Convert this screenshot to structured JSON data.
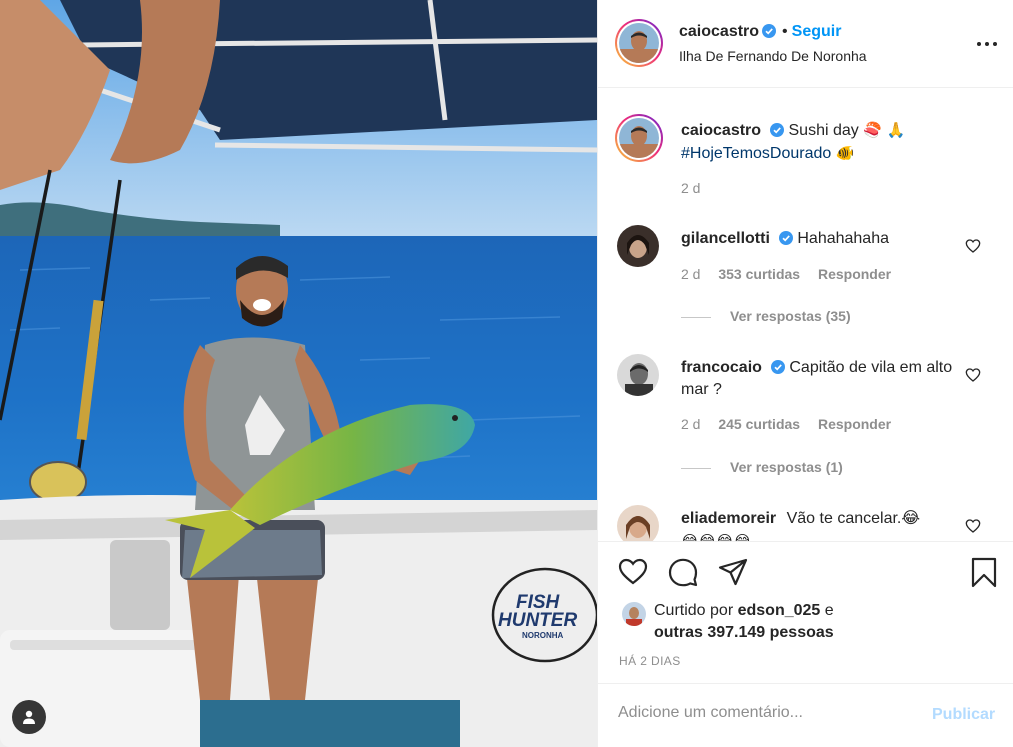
{
  "colors": {
    "accent": "#0095f6",
    "text": "#262626",
    "muted": "#8e8e8e",
    "hashtag": "#00376b",
    "publish_disabled": "#b3dbff",
    "verified": "#3897f0"
  },
  "media": {
    "tag_icon": "user-tag-icon",
    "boat_logo_line1": "FISH",
    "boat_logo_line2": "HUNTER",
    "boat_logo_line3": "NORONHA"
  },
  "header": {
    "username": "caiocastro",
    "verified": true,
    "separator": "•",
    "follow_label": "Seguir",
    "location": "Ilha De Fernando De Noronha",
    "more_icon": "more-options-icon"
  },
  "caption": {
    "username": "caiocastro",
    "text": "Sushi day",
    "emojis": "🍣 🙏",
    "hashtag": "#HojeTemosDourado",
    "hashtag_emoji": "🐠",
    "time": "2 d"
  },
  "comments": [
    {
      "username": "gilancellotti",
      "verified": true,
      "text": "Hahahahaha",
      "time": "2 d",
      "likes": "353 curtidas",
      "reply_label": "Responder",
      "view_replies": "Ver respostas (35)"
    },
    {
      "username": "francocaio",
      "verified": true,
      "text": "Capitão de vila em alto mar ?",
      "time": "2 d",
      "likes": "245 curtidas",
      "reply_label": "Responder",
      "view_replies": "Ver respostas (1)"
    },
    {
      "username": "eliademoreir",
      "verified": false,
      "text": "Vão te cancelar.😂",
      "text_cont": "😂😂😂😂"
    }
  ],
  "actions": {
    "icons": [
      "heart-icon",
      "comment-icon",
      "share-icon",
      "bookmark-icon"
    ],
    "liked_by_prefix": "Curtido por",
    "liked_by_user": "edson_025",
    "liked_by_and": "e",
    "liked_by_others": "outras 397.149 pessoas",
    "time_ago": "HÁ 2 DIAS"
  },
  "add_comment": {
    "placeholder": "Adicione um comentário...",
    "publish_label": "Publicar"
  }
}
